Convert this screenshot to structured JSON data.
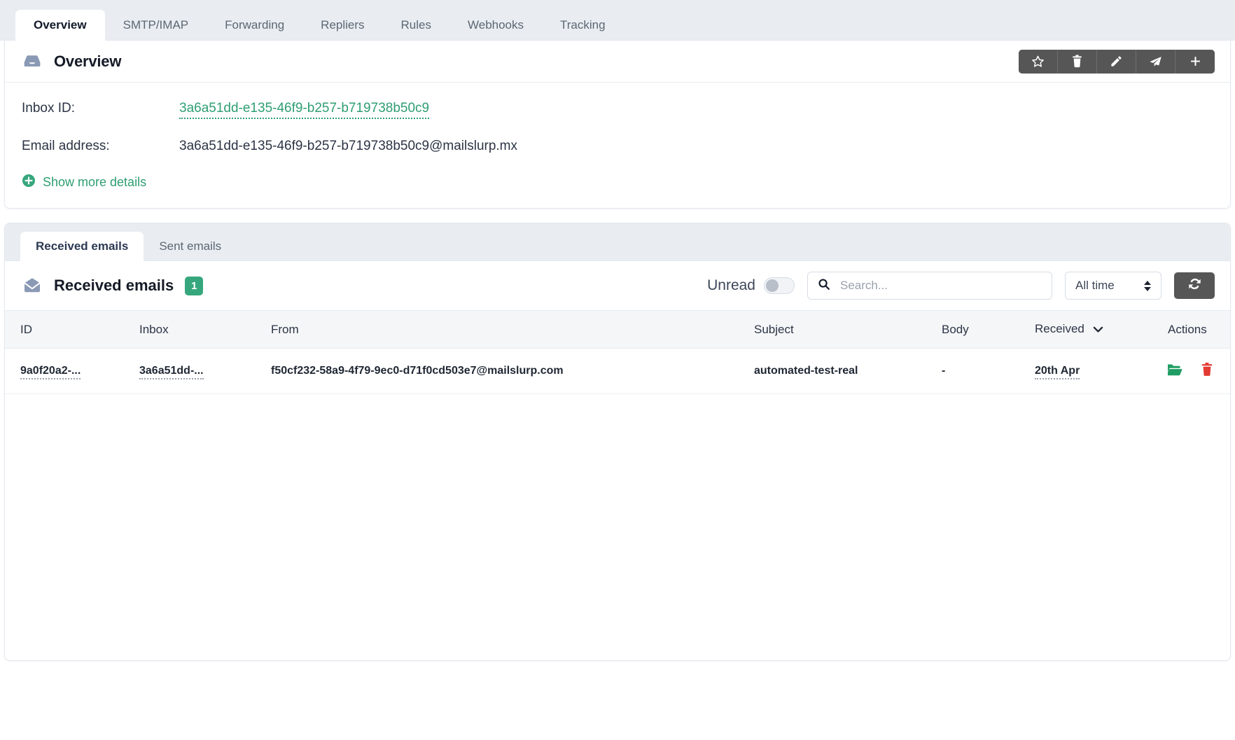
{
  "top_tabs": [
    {
      "label": "Overview",
      "active": true
    },
    {
      "label": "SMTP/IMAP",
      "active": false
    },
    {
      "label": "Forwarding",
      "active": false
    },
    {
      "label": "Repliers",
      "active": false
    },
    {
      "label": "Rules",
      "active": false
    },
    {
      "label": "Webhooks",
      "active": false
    },
    {
      "label": "Tracking",
      "active": false
    }
  ],
  "overview": {
    "icon": "inbox-icon",
    "title": "Overview",
    "actions": [
      {
        "name": "favorite-button",
        "icon": "star-icon"
      },
      {
        "name": "delete-button",
        "icon": "trash-icon"
      },
      {
        "name": "edit-button",
        "icon": "pencil-icon"
      },
      {
        "name": "send-button",
        "icon": "paper-plane-icon"
      },
      {
        "name": "add-button",
        "icon": "plus-icon"
      }
    ],
    "fields": [
      {
        "key": "Inbox ID:",
        "value": "3a6a51dd-e135-46f9-b257-b719738b50c9",
        "is_link": true
      },
      {
        "key": "Email address:",
        "value": "3a6a51dd-e135-46f9-b257-b719738b50c9@mailslurp.mx",
        "is_link": false
      }
    ],
    "show_more_label": "Show more details",
    "show_more_icon": "plus-circle-icon"
  },
  "emails_panel": {
    "tabs": [
      {
        "label": "Received emails",
        "active": true
      },
      {
        "label": "Sent emails",
        "active": false
      }
    ],
    "icon": "envelope-open-icon",
    "title": "Received emails",
    "count_badge": "1",
    "unread_label": "Unread",
    "unread_on": false,
    "search": {
      "value": "",
      "placeholder": "Search...",
      "icon": "search-icon"
    },
    "time_filter": {
      "value": "All time",
      "icon": "updown-arrows-icon"
    },
    "refresh": {
      "icon": "refresh-icon"
    },
    "table": {
      "columns": [
        "ID",
        "Inbox",
        "From",
        "Subject",
        "Body",
        "Received",
        "Actions"
      ],
      "sorted_column": "Received",
      "sort_icon": "chevron-down-icon",
      "rows": [
        {
          "id": "9a0f20a2-...",
          "inbox": "3a6a51dd-...",
          "from": "f50cf232-58a9-4f79-9ec0-d71f0cd503e7@mailslurp.com",
          "subject": "automated-test-real",
          "body": "-",
          "received": "20th Apr",
          "actions": [
            {
              "name": "open-email-button",
              "icon": "folder-open-icon"
            },
            {
              "name": "delete-email-button",
              "icon": "trash-icon"
            }
          ]
        }
      ]
    }
  },
  "colors": {
    "accent_green": "#2e9e72",
    "badge_green": "#36a77c",
    "danger_red": "#e23b33",
    "dark_button": "#565656",
    "icon_slate": "#8a9ab5",
    "tabstrip_bg": "#e9edf1"
  }
}
